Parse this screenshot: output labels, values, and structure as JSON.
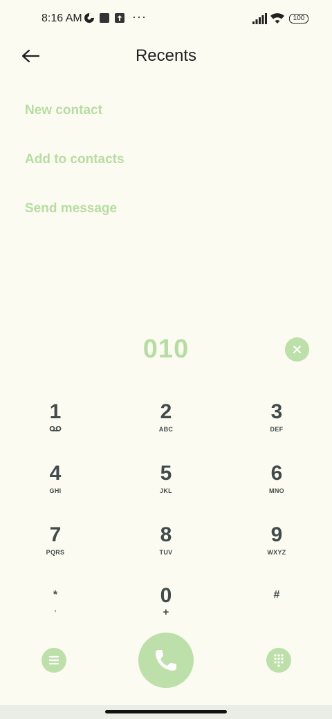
{
  "status_bar": {
    "time": "8:16 AM",
    "icons": [
      "lens-icon",
      "square-icon",
      "upload-icon"
    ],
    "overflow": "···",
    "battery": "100"
  },
  "header": {
    "back_icon": "arrow-left-icon",
    "title": "Recents"
  },
  "actions": [
    {
      "label": "New contact"
    },
    {
      "label": "Add to contacts"
    },
    {
      "label": "Send message"
    }
  ],
  "dialer": {
    "number": "010",
    "clear_icon": "close-icon"
  },
  "keypad": [
    {
      "digit": "1",
      "letters": "",
      "sub_icon": "voicemail-icon"
    },
    {
      "digit": "2",
      "letters": "ABC"
    },
    {
      "digit": "3",
      "letters": "DEF"
    },
    {
      "digit": "4",
      "letters": "GHI"
    },
    {
      "digit": "5",
      "letters": "JKL"
    },
    {
      "digit": "6",
      "letters": "MNO"
    },
    {
      "digit": "7",
      "letters": "PQRS"
    },
    {
      "digit": "8",
      "letters": "TUV"
    },
    {
      "digit": "9",
      "letters": "WXYZ"
    },
    {
      "digit": "*",
      "letters": ","
    },
    {
      "digit": "0",
      "letters": "+"
    },
    {
      "digit": "#",
      "letters": ""
    }
  ],
  "bottom_bar": {
    "menu_icon": "menu-icon",
    "call_icon": "phone-icon",
    "dialpad_icon": "dialpad-icon"
  },
  "colors": {
    "accent": "#bddfaa",
    "background": "#fcfbf1",
    "key_text": "#414b4b"
  }
}
